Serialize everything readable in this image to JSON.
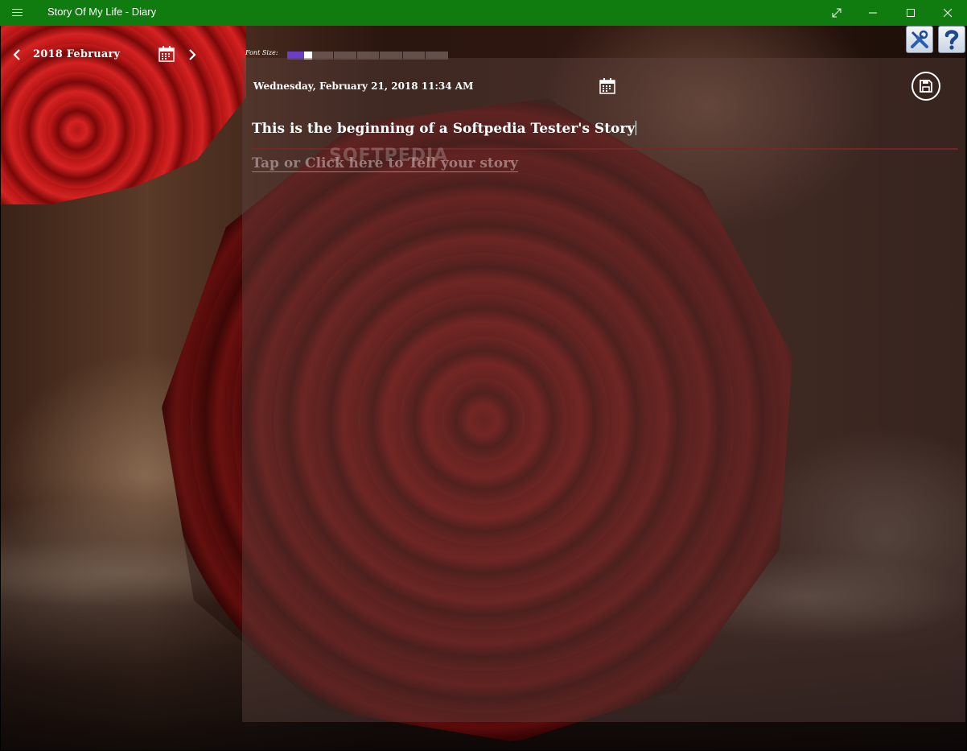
{
  "window": {
    "title": "Story Of My Life - Diary",
    "accent": "#107c10",
    "controls": [
      "expand-icon",
      "minimize-icon",
      "maximize-icon",
      "close-icon"
    ]
  },
  "navigation": {
    "month_label": "2018 February",
    "prev_icon": "chevron-left-icon",
    "next_icon": "chevron-right-icon",
    "calendar_icon": "calendar-icon"
  },
  "font_size": {
    "label": "Font Size:",
    "level": 1,
    "levels": 7,
    "fill_color": "#6a3fc4"
  },
  "toolbar": {
    "settings_icon": "tools-icon",
    "help_icon": "help-icon"
  },
  "entry": {
    "date": "Wednesday, February 21, 2018 11:34 AM",
    "title": "This is the beginning of a Softpedia Tester's Story",
    "story_placeholder": "Tap or Click here to Tell your story",
    "save_icon": "save-icon"
  },
  "watermark": "SOFTPEDIA"
}
